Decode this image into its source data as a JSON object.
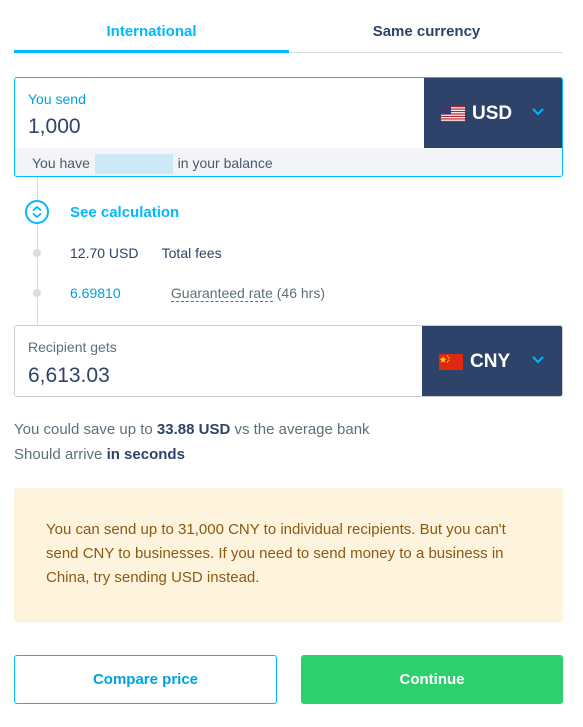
{
  "tabs": [
    {
      "label": "International",
      "active": true
    },
    {
      "label": "Same currency",
      "active": false
    }
  ],
  "send": {
    "label": "You send",
    "amount": "1,000",
    "currency": "USD",
    "flag": "us-flag",
    "balance_prefix": "You have",
    "balance_suffix": "in your balance"
  },
  "calculation": {
    "link": "See calculation",
    "fee_amount": "12.70 USD",
    "fee_label": "Total fees",
    "rate": "6.69810",
    "rate_label": "Guaranteed rate",
    "rate_hours": "(46 hrs)"
  },
  "receive": {
    "label": "Recipient gets",
    "amount": "6,613.03",
    "currency": "CNY",
    "flag": "cn-flag"
  },
  "savings": {
    "prefix": "You could save up to",
    "amount": "33.88 USD",
    "suffix": "vs the average bank"
  },
  "arrival": {
    "prefix": "Should arrive",
    "value": "in seconds"
  },
  "alert": {
    "text": "You can send up to 31,000 CNY to individual recipients. But you can't send CNY to businesses. If you need to send money to a business in China, try sending USD instead."
  },
  "buttons": {
    "compare": "Compare price",
    "continue": "Continue"
  },
  "colors": {
    "accent": "#00b9ff",
    "navy": "#2e4369",
    "green": "#2ed06e",
    "alert_bg": "#fef3dd"
  }
}
